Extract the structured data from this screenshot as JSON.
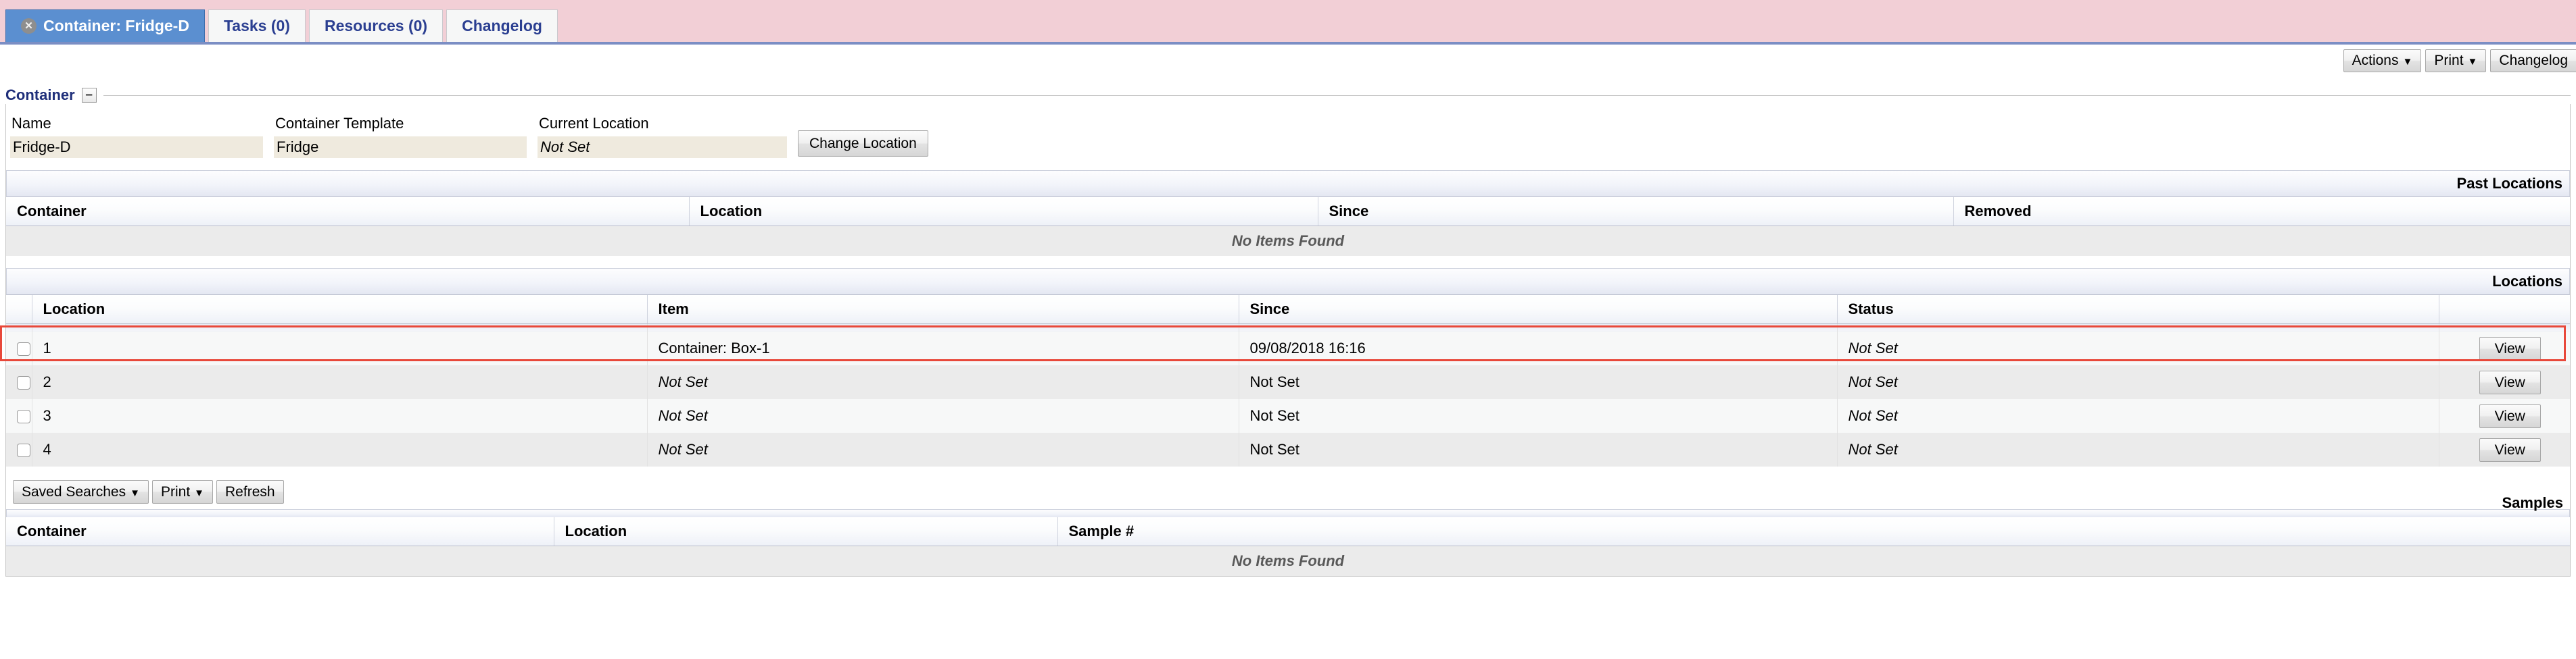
{
  "tabs": [
    {
      "label": "Container: Fridge-D",
      "active": true,
      "closable": true
    },
    {
      "label": "Tasks (0)",
      "active": false,
      "closable": false
    },
    {
      "label": "Resources (0)",
      "active": false,
      "closable": false
    },
    {
      "label": "Changelog",
      "active": false,
      "closable": false
    }
  ],
  "toolbar": {
    "actions_label": "Actions",
    "print_label": "Print",
    "changelog_label": "Changelog",
    "caret": "▼"
  },
  "panel": {
    "title": "Container",
    "collapse_glyph": "–"
  },
  "fields": {
    "name": {
      "label": "Name",
      "value": "Fridge-D",
      "italic": false
    },
    "container_template": {
      "label": "Container Template",
      "value": "Fridge",
      "italic": false
    },
    "current_location": {
      "label": "Current Location",
      "value": "Not Set",
      "italic": true
    },
    "change_location_label": "Change Location"
  },
  "past_locations": {
    "caption": "Past Locations",
    "columns": [
      "Container",
      "Location",
      "Since",
      "Removed"
    ],
    "rows": [],
    "empty_text": "No Items Found"
  },
  "locations": {
    "caption": "Locations",
    "columns": [
      "Location",
      "Item",
      "Since",
      "Status"
    ],
    "view_label": "View",
    "rows": [
      {
        "location": "1",
        "item": "Container: Box-1",
        "item_italic": false,
        "since": "09/08/2018 16:16",
        "since_italic": false,
        "status": "Not Set",
        "status_italic": true,
        "highlighted": true
      },
      {
        "location": "2",
        "item": "Not Set",
        "item_italic": true,
        "since": "Not Set",
        "since_italic": false,
        "status": "Not Set",
        "status_italic": true,
        "highlighted": false
      },
      {
        "location": "3",
        "item": "Not Set",
        "item_italic": true,
        "since": "Not Set",
        "since_italic": false,
        "status": "Not Set",
        "status_italic": true,
        "highlighted": false
      },
      {
        "location": "4",
        "item": "Not Set",
        "item_italic": true,
        "since": "Not Set",
        "since_italic": false,
        "status": "Not Set",
        "status_italic": true,
        "highlighted": false
      }
    ]
  },
  "samples_toolbar": {
    "saved_searches_label": "Saved Searches",
    "print_label": "Print",
    "refresh_label": "Refresh",
    "caret": "▼"
  },
  "samples": {
    "caption": "Samples",
    "columns": [
      "Container",
      "Location",
      "Sample #"
    ],
    "rows": [],
    "empty_text": "No Items Found"
  },
  "colors": {
    "tabbar_bg": "#f2cfd6",
    "active_tab_bg": "#5b8fd0",
    "tab_text": "#2b3f91",
    "panel_title": "#1f2f7a",
    "field_value_bg": "#efeade",
    "highlight_border": "#e8483a"
  }
}
